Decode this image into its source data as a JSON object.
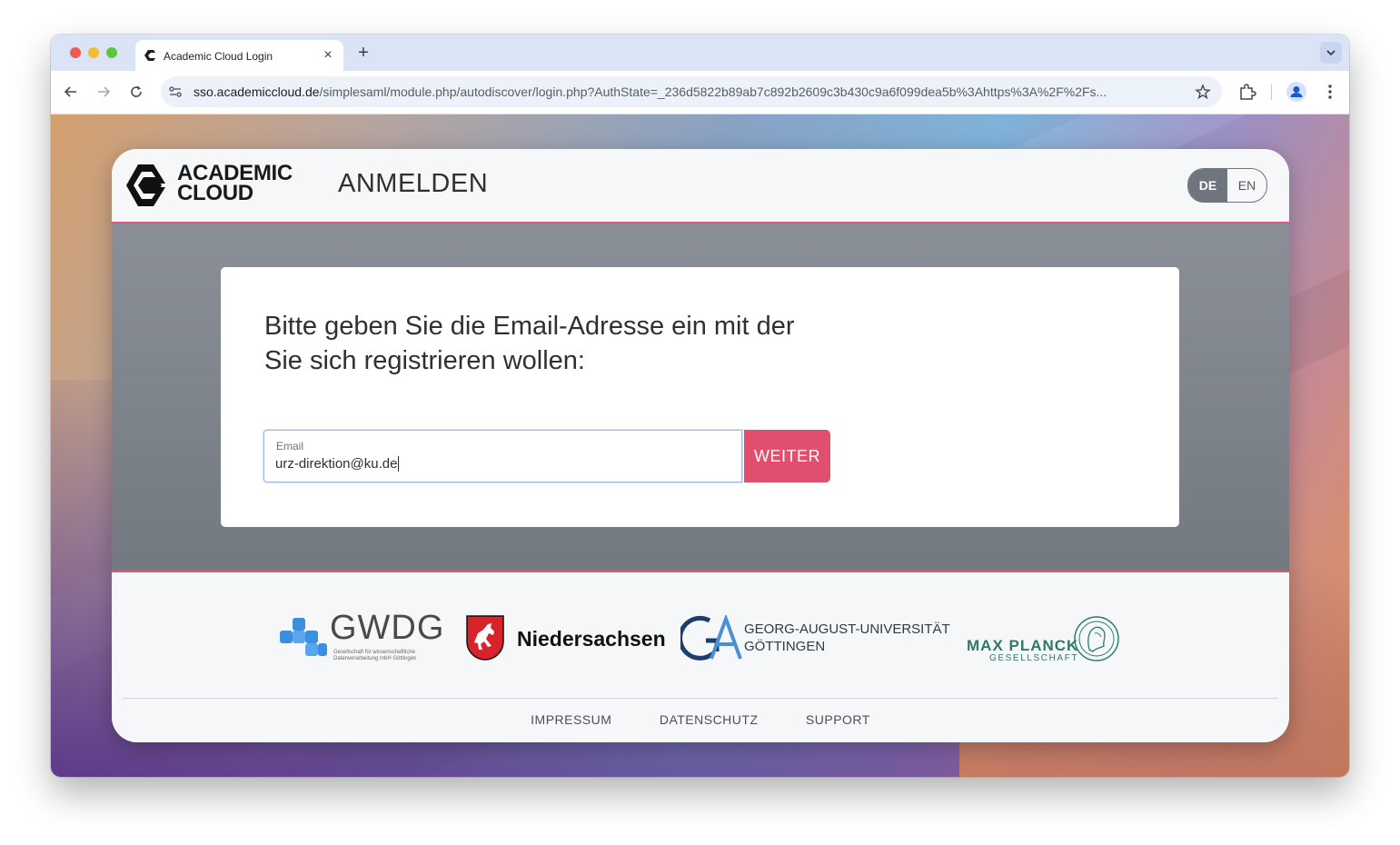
{
  "browser": {
    "tab_title": "Academic Cloud Login",
    "url_host": "sso.academiccloud.de",
    "url_path": "/simplesaml/module.php/autodiscover/login.php?AuthState=_236d5822b89ab7c892b2609c3b430c9a6f099dea5b%3Ahttps%3A%2F%2Fs..."
  },
  "header": {
    "logo_line1": "ACADEMIC",
    "logo_line2": "CLOUD",
    "title": "ANMELDEN",
    "languages": [
      "DE",
      "EN"
    ],
    "active_language": "DE"
  },
  "form": {
    "prompt": "Bitte geben Sie die Email-Adresse ein mit der Sie sich registrieren wollen:",
    "email_label": "Email",
    "email_value": "urz-direktion@ku.de",
    "submit_label": "WEITER"
  },
  "partners": {
    "gwdg_name": "GWDG",
    "gwdg_subtitle": "Gesellschaft für wissenschaftliche Datenverarbeitung mbH Göttingen",
    "niedersachsen": "Niedersachsen",
    "uni_line1": "GEORG-AUGUST-UNIVERSITÄT",
    "uni_line2": "GÖTTINGEN",
    "mpg_name": "MAX PLANCK",
    "mpg_subtitle": "GESELLSCHAFT"
  },
  "footer": {
    "links": [
      "IMPRESSUM",
      "DATENSCHUTZ",
      "SUPPORT"
    ]
  },
  "colors": {
    "accent": "#e0506e",
    "header_divider": "#dc5a73",
    "lang_active": "#6f757d",
    "mpg_green": "#2e7a66",
    "gwdg_blue": "#3a8fe0"
  }
}
